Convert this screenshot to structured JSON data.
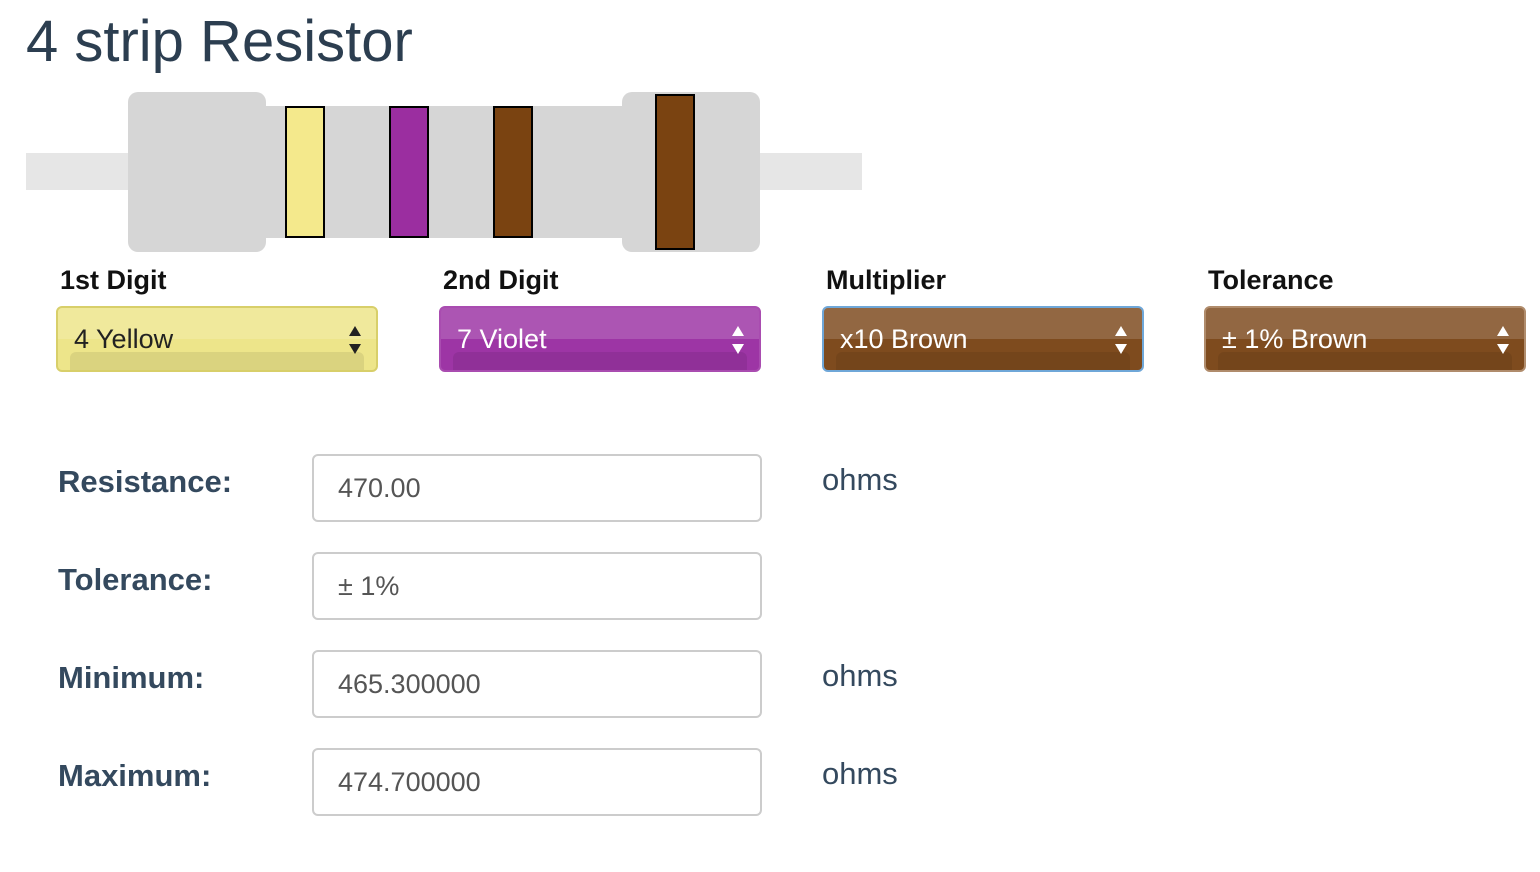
{
  "page": {
    "title": "4 strip Resistor"
  },
  "resistor": {
    "wire_color": "#e6e6e6",
    "body_color": "#d6d6d6",
    "bands": [
      {
        "name": "1st Digit",
        "color": "#f4e98c"
      },
      {
        "name": "2nd Digit",
        "color": "#9b2ea0"
      },
      {
        "name": "Multiplier",
        "color": "#7a4311"
      },
      {
        "name": "Tolerance",
        "color": "#7a4311"
      }
    ]
  },
  "selectors": [
    {
      "label": "1st Digit",
      "value": "4 Yellow",
      "bg_color": "#ede58a",
      "text_color": "#222222",
      "border_color": "#d8cf6a"
    },
    {
      "label": "2nd Digit",
      "value": "7 Violet",
      "bg_color": "#9d35a5",
      "text_color": "#ffffff",
      "border_color": "#a94cb0"
    },
    {
      "label": "Multiplier",
      "value": "x10 Brown",
      "bg_color": "#7e4b1e",
      "text_color": "#ffffff",
      "border_color": "#6fa7d8"
    },
    {
      "label": "Tolerance",
      "value": "± 1% Brown",
      "bg_color": "#7e4b1e",
      "text_color": "#ffffff",
      "border_color": "#b08c6c"
    }
  ],
  "results": {
    "resistance": {
      "label": "Resistance:",
      "value": "470.00",
      "unit": "ohms"
    },
    "tolerance": {
      "label": "Tolerance:",
      "value": "± 1%",
      "unit": ""
    },
    "minimum": {
      "label": "Minimum:",
      "value": "465.300000",
      "unit": "ohms"
    },
    "maximum": {
      "label": "Maximum:",
      "value": "474.700000",
      "unit": "ohms"
    }
  }
}
